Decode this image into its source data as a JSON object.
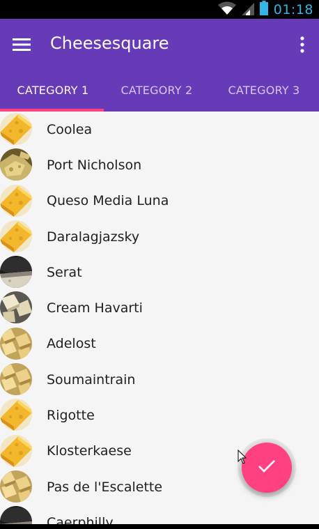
{
  "status_bar": {
    "time": "01:18",
    "time_color": "#33b5e5",
    "icons": [
      "wifi-icon",
      "signal-icon",
      "battery-icon"
    ]
  },
  "app_bar": {
    "title": "Cheesesquare",
    "color": "#673ab7",
    "menu_icon": "hamburger-menu-icon",
    "overflow_icon": "more-vert-icon"
  },
  "tabs": [
    {
      "label": "CATEGORY 1",
      "active": true
    },
    {
      "label": "CATEGORY 2",
      "active": false
    },
    {
      "label": "CATEGORY 3",
      "active": false
    }
  ],
  "tab_indicator_color": "#ff4081",
  "cheeses": [
    {
      "name": "Coolea",
      "image": "yellow-wedge"
    },
    {
      "name": "Port Nicholson",
      "image": "crumbly-yellow"
    },
    {
      "name": "Queso Media Luna",
      "image": "yellow-wedge"
    },
    {
      "name": "Daralagjazsky",
      "image": "yellow-wedge"
    },
    {
      "name": "Serat",
      "image": "dark-wheel"
    },
    {
      "name": "Cream Havarti",
      "image": "pale-chunks"
    },
    {
      "name": "Adelost",
      "image": "cubes"
    },
    {
      "name": "Soumaintrain",
      "image": "cubes"
    },
    {
      "name": "Rigotte",
      "image": "yellow-wedge"
    },
    {
      "name": "Klosterkaese",
      "image": "yellow-wedge"
    },
    {
      "name": "Pas de l'Escalette",
      "image": "cubes"
    },
    {
      "name": "Caerphilly",
      "image": "dark-wheel"
    }
  ],
  "fab": {
    "icon": "check-icon",
    "color": "#ff4081"
  }
}
